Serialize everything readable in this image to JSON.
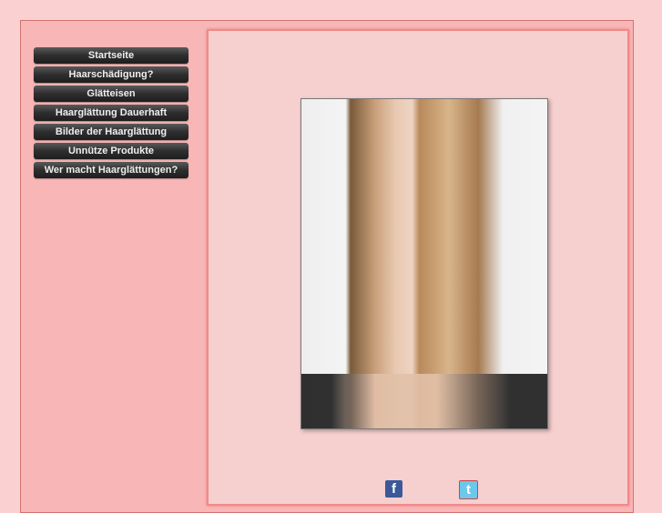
{
  "nav": {
    "items": [
      {
        "label": "Startseite"
      },
      {
        "label": "Haarschädigung?"
      },
      {
        "label": "Glätteisen"
      },
      {
        "label": "Haarglättung Dauerhaft"
      },
      {
        "label": "Bilder der Haarglättung"
      },
      {
        "label": "Unnütze Produkte"
      },
      {
        "label": "Wer macht Haarglättungen?"
      }
    ]
  },
  "social": {
    "facebook_glyph": "f",
    "twitter_glyph": "t"
  },
  "colors": {
    "background": "#fbd0d0",
    "panel": "#f6cfcf",
    "button": "#2e2e2e"
  }
}
